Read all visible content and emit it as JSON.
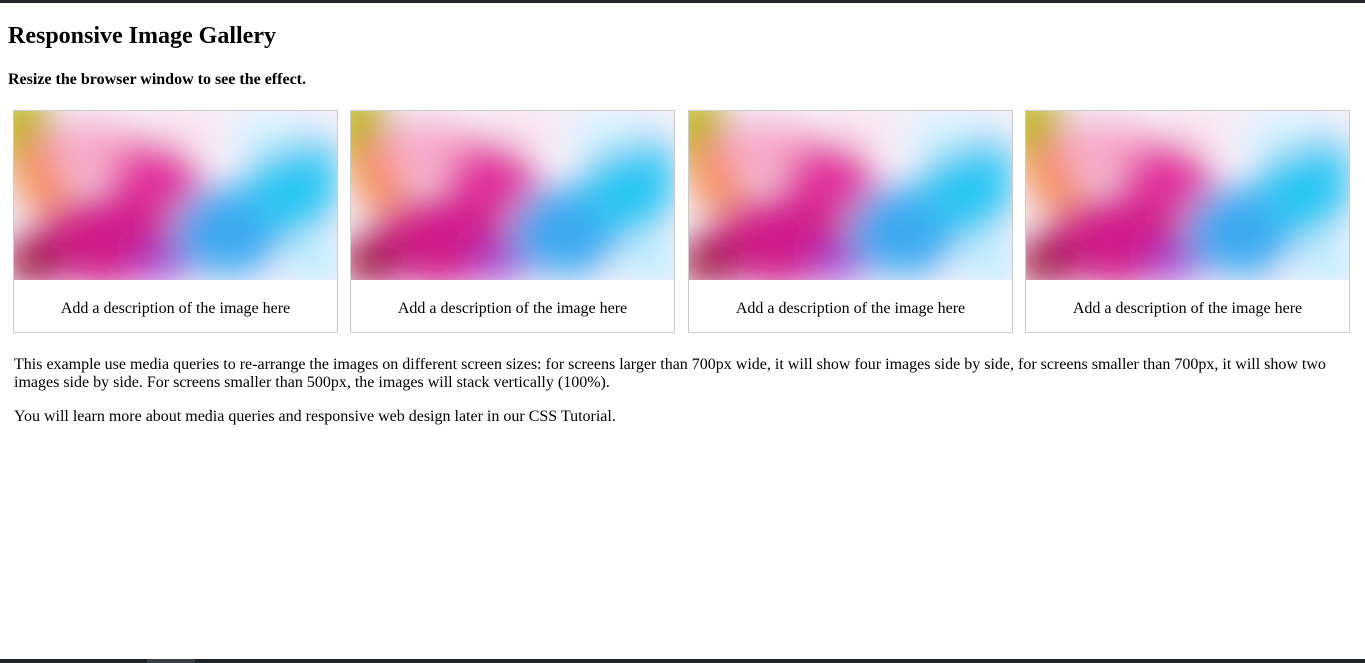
{
  "page": {
    "title": "Responsive Image Gallery",
    "subtitle": "Resize the browser window to see the effect."
  },
  "gallery": {
    "items": [
      {
        "description": "Add a description of the image here",
        "image": "colorful-powder-splash-image"
      },
      {
        "description": "Add a description of the image here",
        "image": "colorful-powder-splash-image"
      },
      {
        "description": "Add a description of the image here",
        "image": "colorful-powder-splash-image"
      },
      {
        "description": "Add a description of the image here",
        "image": "colorful-powder-splash-image"
      }
    ]
  },
  "info": {
    "paragraph1": "This example use media queries to re-arrange the images on different screen sizes: for screens larger than 700px wide, it will show four images side by side, for screens smaller than 700px, it will show two images side by side. For screens smaller than 500px, the images will stack vertically (100%).",
    "paragraph2": "You will learn more about media queries and responsive web design later in our CSS Tutorial."
  },
  "colors": {
    "border": "#cccccc",
    "text": "#000000",
    "background": "#ffffff"
  }
}
